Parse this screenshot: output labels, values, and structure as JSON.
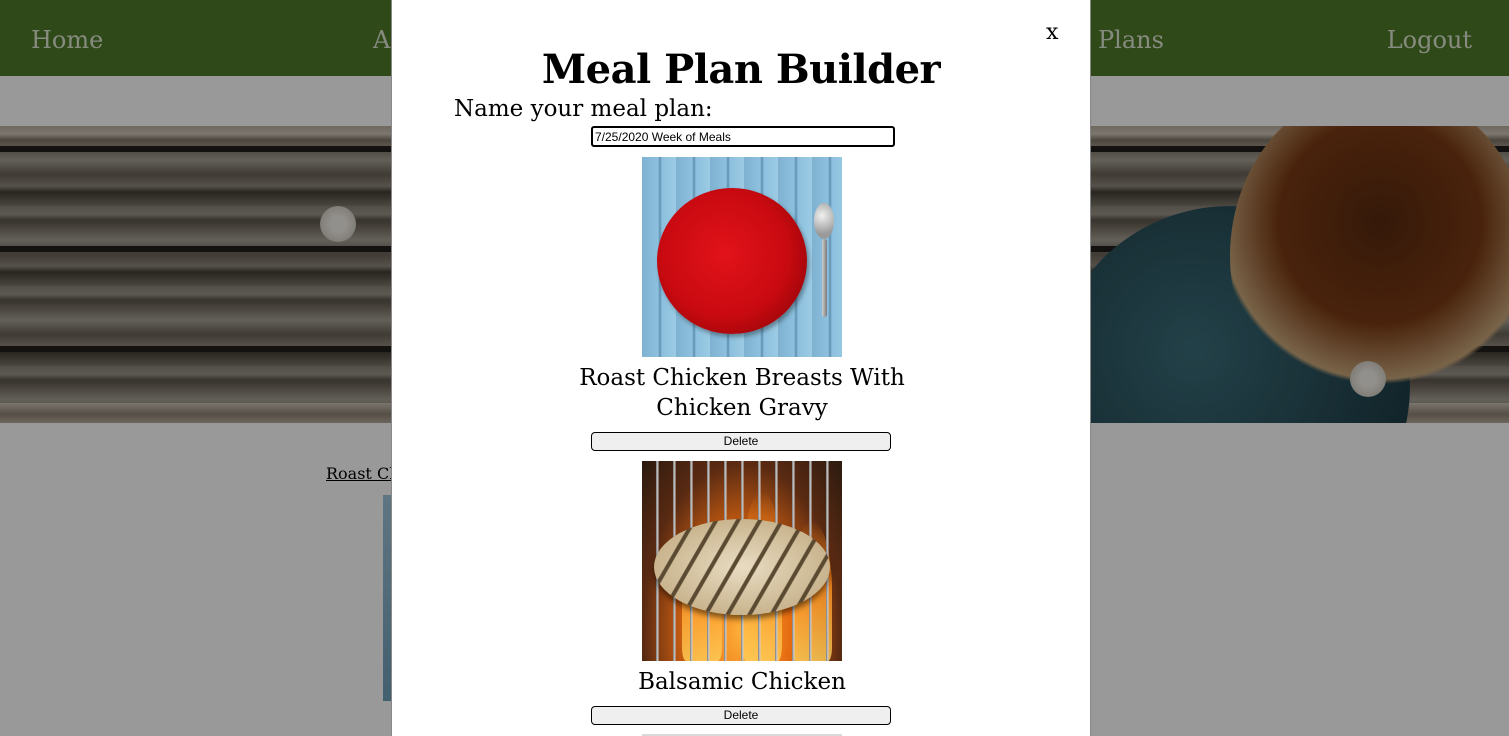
{
  "nav": {
    "home": "Home",
    "second_partial": "A",
    "plans": "Plans",
    "logout": "Logout"
  },
  "background": {
    "recipe_link_partial": "Roast Ch"
  },
  "modal": {
    "close_label": "x",
    "title": "Meal Plan Builder",
    "name_label": "Name your meal plan:",
    "name_value": "7/25/2020 Week of Meals",
    "meals": [
      {
        "title": "Roast Chicken Breasts With Chicken Gravy",
        "image": "red-plate-image",
        "delete_label": "Delete"
      },
      {
        "title": "Balsamic Chicken",
        "image": "grilled-chicken-image",
        "delete_label": "Delete"
      }
    ]
  },
  "colors": {
    "navbar": "#4f7a28",
    "nav_text": "#dfe8d4",
    "overlay": "rgba(0,0,0,0.40)",
    "modal_bg": "#ffffff"
  }
}
